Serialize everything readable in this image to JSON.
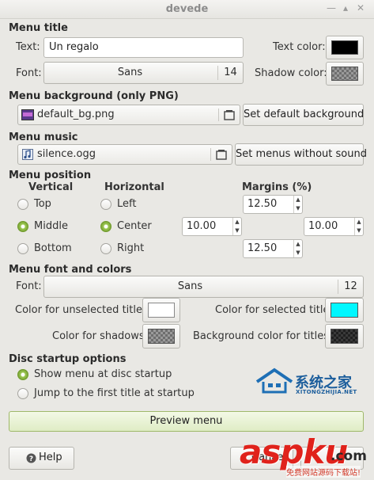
{
  "window": {
    "title": "devede"
  },
  "menu_title": {
    "heading": "Menu title",
    "text_label": "Text:",
    "text_value": "Un regalo",
    "text_color_label": "Text color:",
    "text_color": "#000000",
    "font_label": "Font:",
    "font_name": "Sans",
    "font_size": "14",
    "shadow_color_label": "Shadow color:"
  },
  "menu_background": {
    "heading": "Menu background (only PNG)",
    "file": "default_bg.png",
    "default_button": "Set default background"
  },
  "menu_music": {
    "heading": "Menu music",
    "file": "silence.ogg",
    "no_sound_button": "Set menus without sound"
  },
  "menu_position": {
    "heading": "Menu position",
    "vertical_label": "Vertical",
    "horizontal_label": "Horizontal",
    "margins_label": "Margins (%)",
    "vertical_options": [
      "Top",
      "Middle",
      "Bottom"
    ],
    "vertical_selected": "Middle",
    "horizontal_options": [
      "Left",
      "Center",
      "Right"
    ],
    "horizontal_selected": "Center",
    "margin_top": "12.50",
    "margin_left": "10.00",
    "margin_right": "10.00",
    "margin_bottom": "12.50"
  },
  "font_colors": {
    "heading": "Menu font and colors",
    "font_label": "Font:",
    "font_name": "Sans",
    "font_size": "12",
    "unselected_label": "Color for unselected titles:",
    "unselected_color": "#ffffff",
    "selected_label": "Color for selected title:",
    "selected_color": "#00f7ff",
    "shadows_label": "Color for shadows:",
    "bg_titles_label": "Background color for titles:"
  },
  "disc_startup": {
    "heading": "Disc startup options",
    "options": [
      "Show menu at disc startup",
      "Jump to the first title at startup"
    ],
    "selected": "Show menu at disc startup"
  },
  "preview_button": "Preview menu",
  "help_button": "Help",
  "cancel_button": "Cance",
  "watermarks": {
    "site_name": "系统之家",
    "site_url": "XITONGZHIJIA.NET",
    "asp_logo": "aspku",
    "asp_domain": ".com",
    "asp_slogan": "免费网站源码下载站!"
  }
}
